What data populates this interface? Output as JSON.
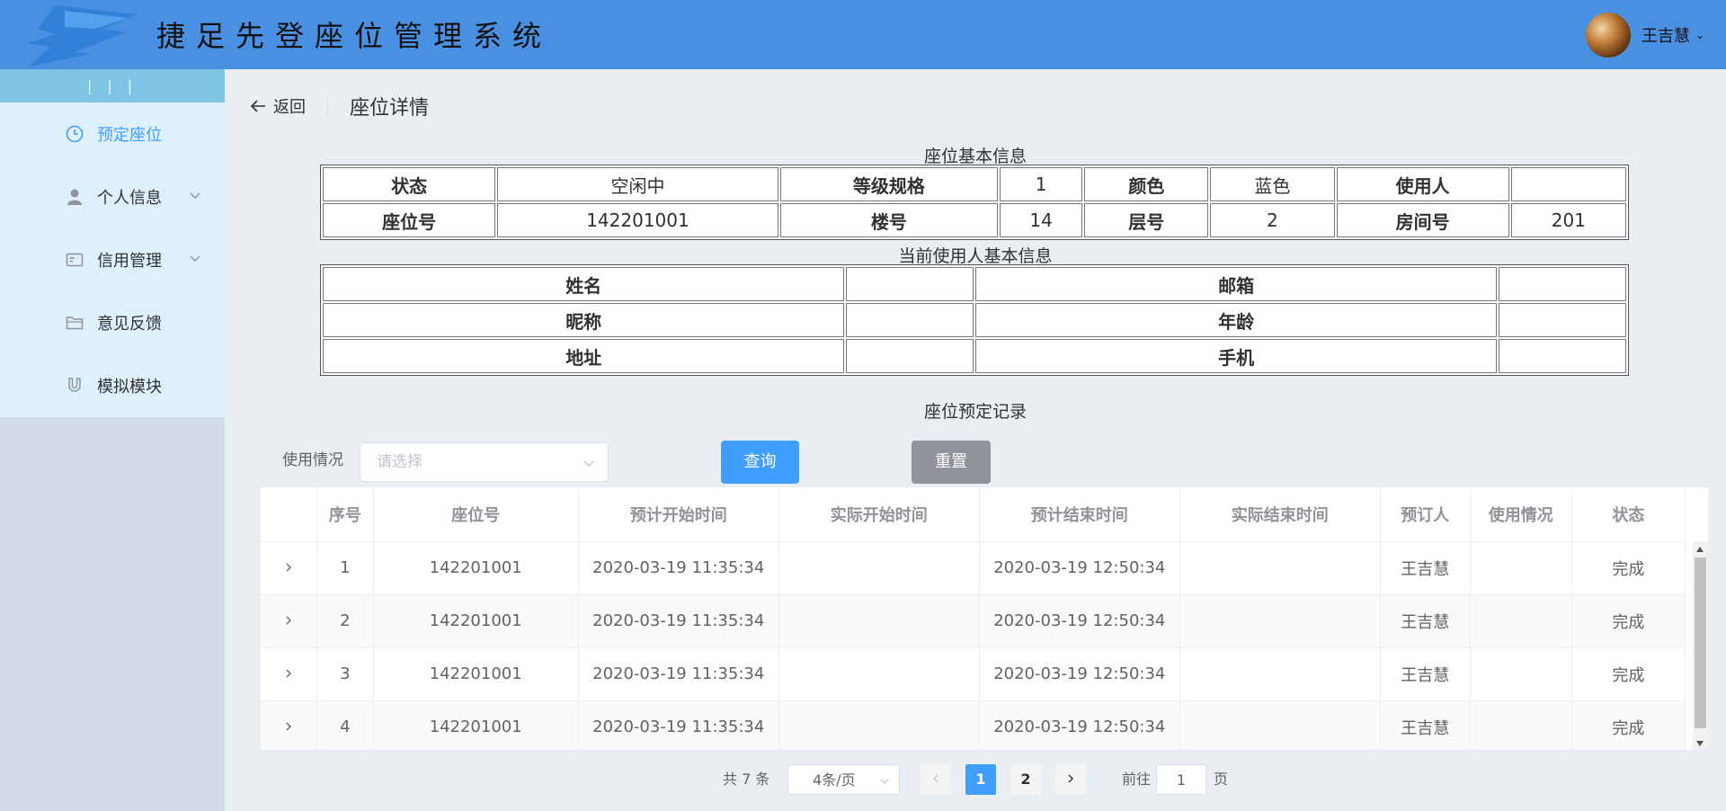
{
  "header": {
    "app_title": "捷足先登座位管理系统",
    "username": "王吉慧",
    "brand_color": "#4a90e2"
  },
  "sidebar": {
    "collapse_label": "| | |",
    "items": [
      {
        "label": "预定座位",
        "icon": "clock-icon",
        "active": true
      },
      {
        "label": "个人信息",
        "icon": "user-icon",
        "has_submenu": true
      },
      {
        "label": "信用管理",
        "icon": "credit-card-icon",
        "has_submenu": true
      },
      {
        "label": "意见反馈",
        "icon": "folder-icon"
      },
      {
        "label": "模拟模块",
        "icon": "magnet-icon"
      }
    ]
  },
  "page": {
    "back_label": "返回",
    "title": "座位详情"
  },
  "seat_info": {
    "title": "座位基本信息",
    "rows": [
      [
        {
          "label": "状态",
          "value": "空闲中"
        },
        {
          "label": "等级规格",
          "value": "1"
        },
        {
          "label": "颜色",
          "value": "蓝色"
        },
        {
          "label": "使用人",
          "value": ""
        }
      ],
      [
        {
          "label": "座位号",
          "value": "142201001"
        },
        {
          "label": "楼号",
          "value": "14"
        },
        {
          "label": "层号",
          "value": "2"
        },
        {
          "label": "房间号",
          "value": "201"
        }
      ]
    ]
  },
  "user_info": {
    "title": "当前使用人基本信息",
    "rows": [
      [
        {
          "label": "姓名",
          "value": ""
        },
        {
          "label": "邮箱",
          "value": ""
        }
      ],
      [
        {
          "label": "昵称",
          "value": ""
        },
        {
          "label": "年龄",
          "value": ""
        }
      ],
      [
        {
          "label": "地址",
          "value": ""
        },
        {
          "label": "手机",
          "value": ""
        }
      ]
    ]
  },
  "records": {
    "title": "座位预定记录",
    "filter_label": "使用情况",
    "select_placeholder": "请选择",
    "query_button": "查询",
    "reset_button": "重置",
    "columns": [
      "",
      "序号",
      "座位号",
      "预计开始时间",
      "实际开始时间",
      "预计结束时间",
      "实际结束时间",
      "预订人",
      "使用情况",
      "状态"
    ],
    "rows": [
      [
        "1",
        "142201001",
        "2020-03-19 11:35:34",
        "",
        "2020-03-19 12:50:34",
        "",
        "王吉慧",
        "",
        "完成"
      ],
      [
        "2",
        "142201001",
        "2020-03-19 11:35:34",
        "",
        "2020-03-19 12:50:34",
        "",
        "王吉慧",
        "",
        "完成"
      ],
      [
        "3",
        "142201001",
        "2020-03-19 11:35:34",
        "",
        "2020-03-19 12:50:34",
        "",
        "王吉慧",
        "",
        "完成"
      ],
      [
        "4",
        "142201001",
        "2020-03-19 11:35:34",
        "",
        "2020-03-19 12:50:34",
        "",
        "王吉慧",
        "",
        "完成"
      ]
    ]
  },
  "pagination": {
    "total_label": "共 7 条",
    "page_size": "4条/页",
    "pages": [
      "1",
      "2"
    ],
    "current_page": "1",
    "goto_label": "前往",
    "goto_value": "1",
    "page_suffix": "页"
  }
}
